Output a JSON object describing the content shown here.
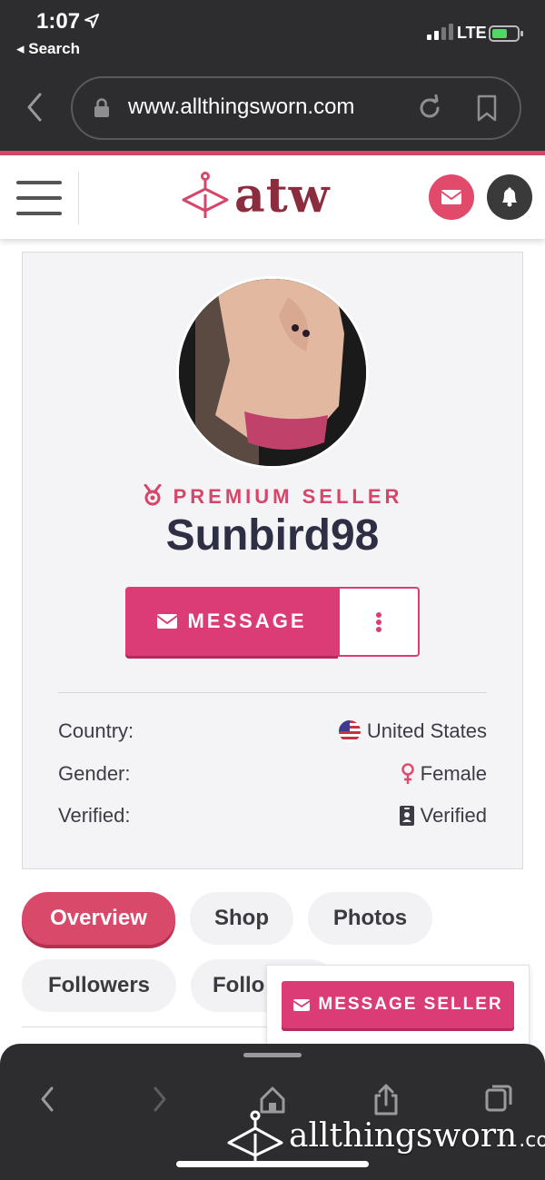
{
  "status_bar": {
    "time": "1:07",
    "back_app": "◂ Search",
    "network": "LTE"
  },
  "browser": {
    "url": "www.allthingsworn.com"
  },
  "site": {
    "logo_text": "atw"
  },
  "profile": {
    "badge": "PREMIUM SELLER",
    "username": "Sunbird98",
    "message_label": "MESSAGE",
    "info": [
      {
        "label": "Country:",
        "value": "United States",
        "icon": "us-flag-icon"
      },
      {
        "label": "Gender:",
        "value": "Female",
        "icon": "female-icon"
      },
      {
        "label": "Verified:",
        "value": "Verified",
        "icon": "id-badge-icon"
      }
    ]
  },
  "tabs": [
    {
      "label": "Overview",
      "active": true
    },
    {
      "label": "Shop",
      "active": false
    },
    {
      "label": "Photos",
      "active": false
    },
    {
      "label": "Followers",
      "active": false
    },
    {
      "label": "Follo",
      "active": false
    }
  ],
  "floating": {
    "message_seller_label": "MESSAGE SELLER"
  },
  "watermark": {
    "text": "allthingsworn",
    "suffix": ".com"
  },
  "colors": {
    "accent": "#dc3c75",
    "brand": "#8b2c3f",
    "chrome": "#2d2d2f"
  }
}
